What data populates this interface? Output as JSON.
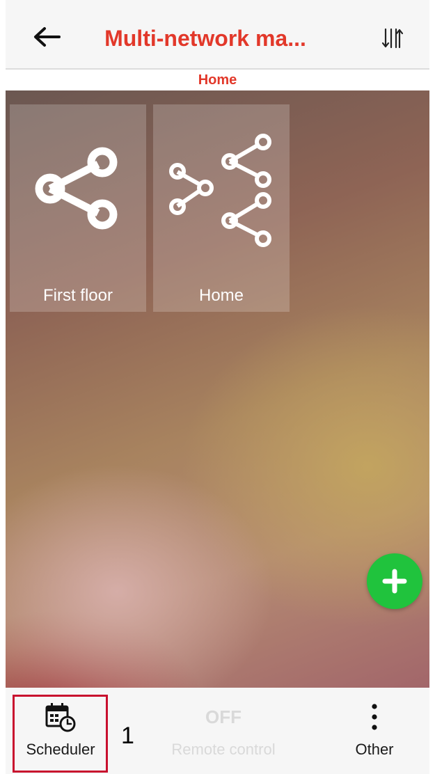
{
  "header": {
    "back_icon": "arrow-left-icon",
    "title": "Multi-network ma...",
    "sort_icon": "sort-arrows-icon",
    "accent_color": "#e2382a"
  },
  "breadcrumb": "Home",
  "tiles": [
    {
      "label": "First floor",
      "icon": "share-network-icon"
    },
    {
      "label": "Home",
      "icon": "multi-network-icon"
    }
  ],
  "fab": {
    "icon": "plus-icon",
    "color": "#20c33d"
  },
  "bottom_nav": {
    "scheduler": {
      "label": "Scheduler",
      "icon": "calendar-clock-icon"
    },
    "remote_control": {
      "label": "Remote control",
      "status": "OFF"
    },
    "other": {
      "label": "Other",
      "icon": "more-vertical-icon"
    }
  },
  "annotation": {
    "step": "1",
    "highlight_color": "#c8102e"
  }
}
